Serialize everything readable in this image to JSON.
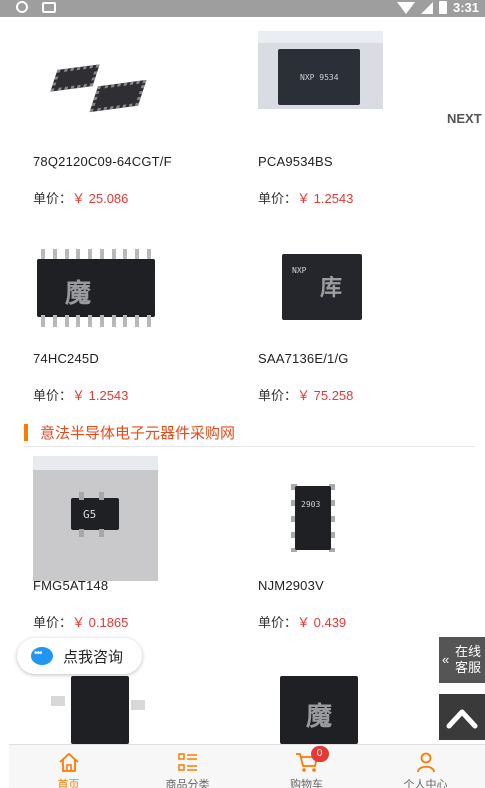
{
  "status_bar": {
    "time": "3:31"
  },
  "carousel": {
    "next_label": "NEXT"
  },
  "products_top": [
    {
      "name": "78Q2120C09-64CGT/F",
      "price_label": "单价：",
      "price": "￥ 25.086"
    },
    {
      "name": "PCA9534BS",
      "price_label": "单价：",
      "price": "￥ 1.2543"
    },
    {
      "name": "74HC245D",
      "price_label": "单价：",
      "price": "￥ 1.2543"
    },
    {
      "name": "SAA7136E/1/G",
      "price_label": "单价：",
      "price": "￥ 75.258"
    }
  ],
  "section": {
    "title": "意法半导体电子元器件采购网"
  },
  "products_section": [
    {
      "name": "FMG5AT148",
      "price_label": "单价：",
      "price": "￥ 0.1865"
    },
    {
      "name": "NJM2903V",
      "price_label": "单价：",
      "price": "￥ 0.439"
    }
  ],
  "consult": {
    "label": "点我咨询"
  },
  "online_service": {
    "label": "在线客服"
  },
  "bottom_nav": {
    "items": [
      {
        "label": "首页",
        "icon": "home-icon"
      },
      {
        "label": "商品分类",
        "icon": "category-icon"
      },
      {
        "label": "购物车",
        "icon": "cart-icon",
        "badge": "0"
      },
      {
        "label": "个人中心",
        "icon": "user-icon"
      }
    ]
  },
  "colors": {
    "accent": "#ff7a00",
    "price": "#e53935",
    "section_title": "#e84a1a"
  }
}
